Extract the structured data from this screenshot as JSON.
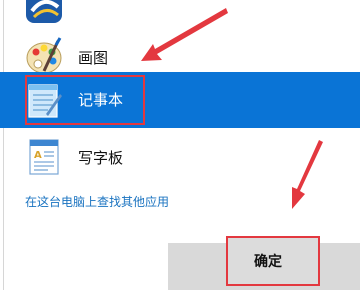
{
  "apps": [
    {
      "id": "partial",
      "label": "",
      "icon": "app-icon-partial",
      "selected": false
    },
    {
      "id": "paint",
      "label": "画图",
      "icon": "paint-palette-icon",
      "selected": false
    },
    {
      "id": "notepad",
      "label": "记事本",
      "icon": "notepad-icon",
      "selected": true
    },
    {
      "id": "wordpad",
      "label": "写字板",
      "icon": "wordpad-icon",
      "selected": false
    }
  ],
  "find_more_link": "在这台电脑上查找其他应用",
  "ok_button_label": "确定",
  "colors": {
    "selection": "#0a74d6",
    "annotation_red": "#e3383f",
    "link": "#1a73c0",
    "button_bg": "#dcdcdc"
  }
}
